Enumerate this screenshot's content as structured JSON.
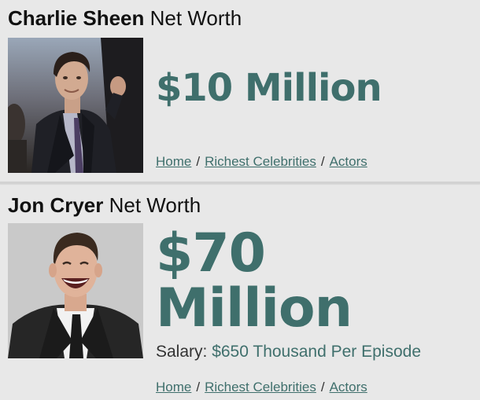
{
  "celebrities": [
    {
      "name": "Charlie Sheen",
      "title_suffix": "Net Worth",
      "net_worth_line1": "$10 Million",
      "net_worth_line2": "",
      "salary_label": "",
      "salary_value": "",
      "breadcrumb": [
        "Home",
        "Richest Celebrities",
        "Actors"
      ],
      "breadcrumb_separator": "/"
    },
    {
      "name": "Jon Cryer",
      "title_suffix": "Net Worth",
      "net_worth_line1": "$70",
      "net_worth_line2": "Million",
      "salary_label": "Salary:",
      "salary_value": "$650 Thousand Per Episode",
      "breadcrumb": [
        "Home",
        "Richest Celebrities",
        "Actors"
      ],
      "breadcrumb_separator": "/"
    }
  ],
  "colors": {
    "accent": "#3f6f6c",
    "background": "#e8e8e8",
    "text": "#111111"
  }
}
